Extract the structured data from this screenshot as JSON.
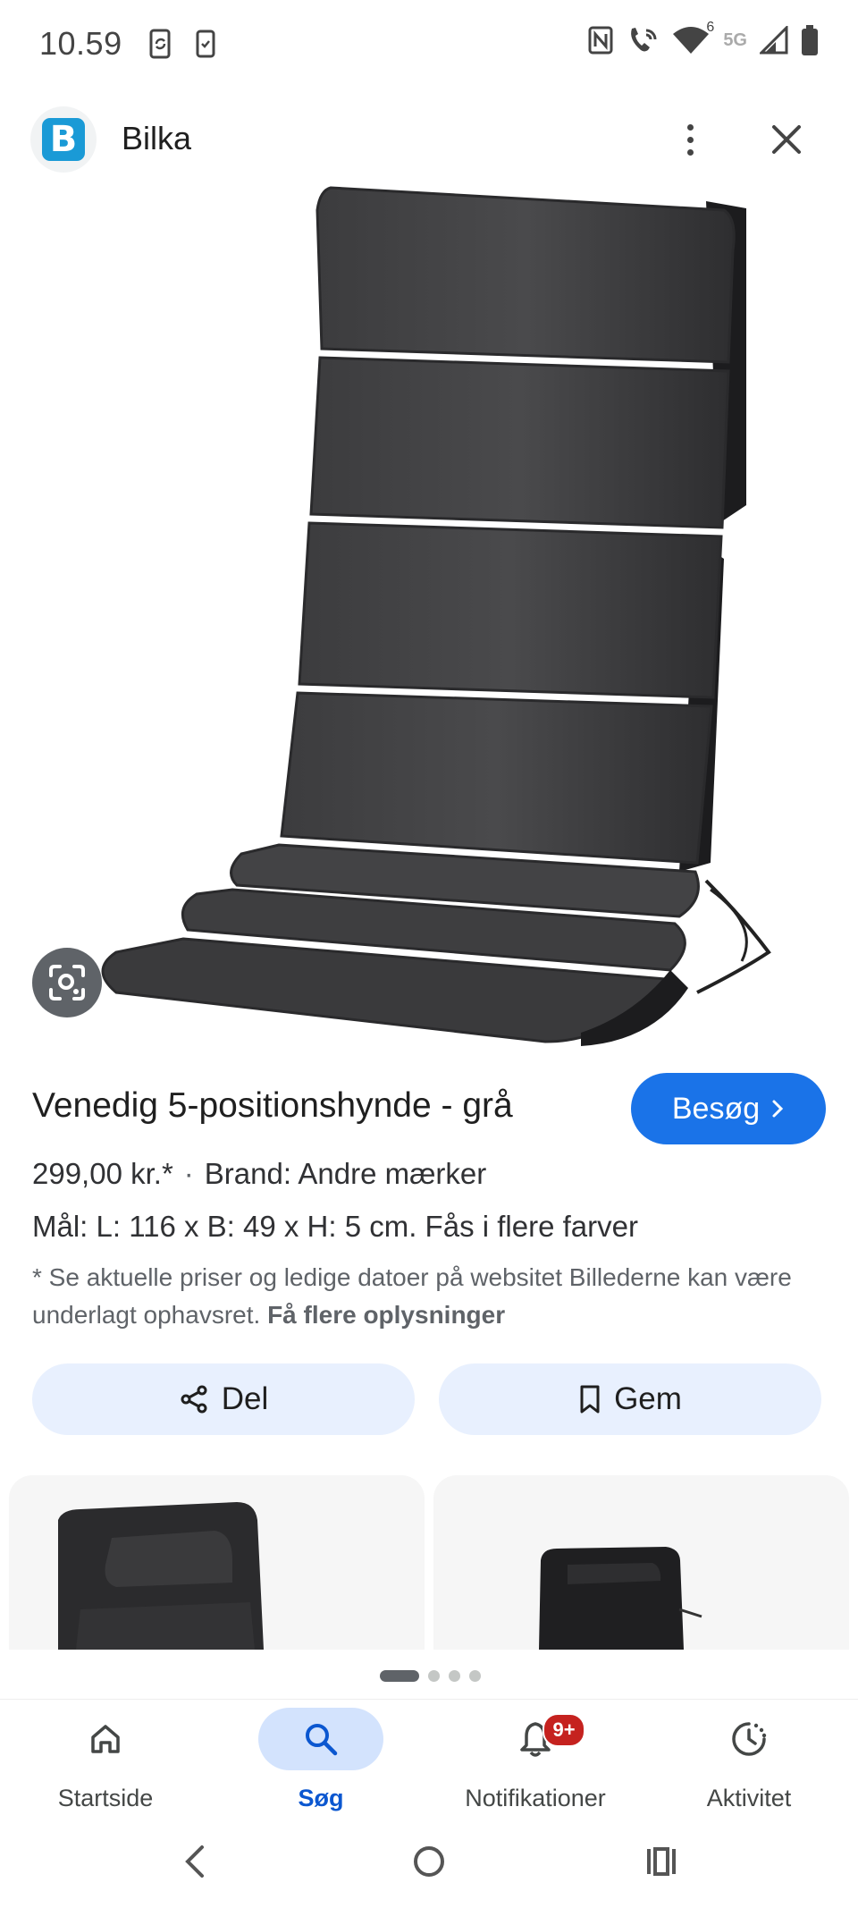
{
  "status_bar": {
    "time": "10.59",
    "signal_label": "5G",
    "wifi_badge": "6"
  },
  "header": {
    "site_name": "Bilka",
    "logo_letter": "B"
  },
  "product": {
    "title": "Venedig 5-positionshynde - grå",
    "visit_label": "Besøg",
    "price": "299,00 kr.*",
    "separator": "·",
    "brand": "Brand: Andre mærker",
    "description": "Mål: L: 116 x B: 49 x H: 5 cm. Fås i flere farver",
    "disclaimer": "* Se aktuelle priser og ledige datoer på websitet Billederne kan være underlagt ophavsret.",
    "more_info": "Få flere oplysninger"
  },
  "actions": {
    "share_label": "Del",
    "save_label": "Gem"
  },
  "bottom_nav": [
    {
      "label": "Startside",
      "icon": "home-icon"
    },
    {
      "label": "Søg",
      "icon": "search-icon"
    },
    {
      "label": "Notifikationer",
      "icon": "bell-icon",
      "badge": "9+"
    },
    {
      "label": "Aktivitet",
      "icon": "activity-icon"
    }
  ],
  "pager": {
    "count": 4,
    "active_index": 0
  },
  "colors": {
    "accent": "#1a73e8",
    "pill_bg": "#e8f0fe",
    "badge": "#c5221f",
    "logo": "#1a9ad6"
  }
}
